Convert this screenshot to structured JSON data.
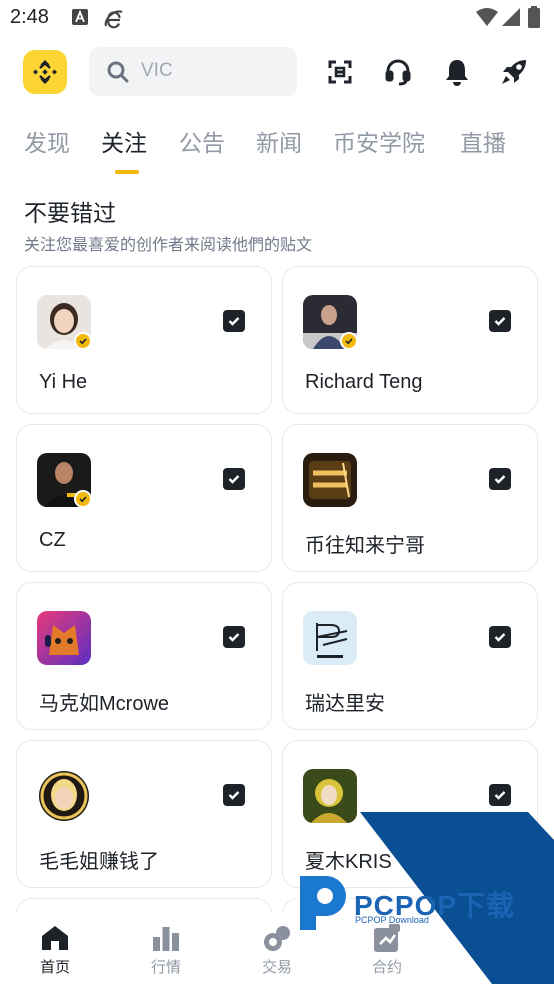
{
  "status_bar": {
    "time": "2:48"
  },
  "header": {
    "search_placeholder": "VIC",
    "icons": [
      "binance-logo",
      "scan-icon",
      "headset-icon",
      "bell-icon",
      "rocket-icon"
    ]
  },
  "tabs": [
    {
      "label": "发现",
      "active": false
    },
    {
      "label": "关注",
      "active": true
    },
    {
      "label": "公告",
      "active": false
    },
    {
      "label": "新闻",
      "active": false
    },
    {
      "label": "币安学院",
      "active": false
    },
    {
      "label": "直播",
      "active": false
    }
  ],
  "section": {
    "title": "不要错过",
    "subtitle": "关注您最喜爱的创作者来阅读他們的贴文"
  },
  "creators": [
    {
      "name": "Yi He",
      "verified": true,
      "checked": true
    },
    {
      "name": "Richard Teng",
      "verified": true,
      "checked": true
    },
    {
      "name": "CZ",
      "verified": true,
      "checked": true
    },
    {
      "name": "币往知来宁哥",
      "verified": false,
      "checked": true
    },
    {
      "name": "马克如Mcrowe",
      "verified": false,
      "checked": true
    },
    {
      "name": "瑞达里安",
      "verified": false,
      "checked": true
    },
    {
      "name": "毛毛姐赚钱了",
      "verified": false,
      "checked": true
    },
    {
      "name": "夏木KRIS",
      "verified": false,
      "checked": true
    }
  ],
  "bottom_nav": [
    {
      "label": "首页",
      "icon": "home-icon",
      "active": true
    },
    {
      "label": "行情",
      "icon": "chart-icon",
      "active": false
    },
    {
      "label": "交易",
      "icon": "trade-icon",
      "active": false
    },
    {
      "label": "合约",
      "icon": "futures-icon",
      "active": false
    }
  ],
  "watermark": {
    "text": "PCPOP下载",
    "sub": "PCPOP Download"
  },
  "colors": {
    "accent": "#f0b90b",
    "brand_yellow": "#fcd535",
    "text_primary": "#1e2329",
    "text_secondary": "#707a8a",
    "watermark_blue": "#0a4f94"
  }
}
